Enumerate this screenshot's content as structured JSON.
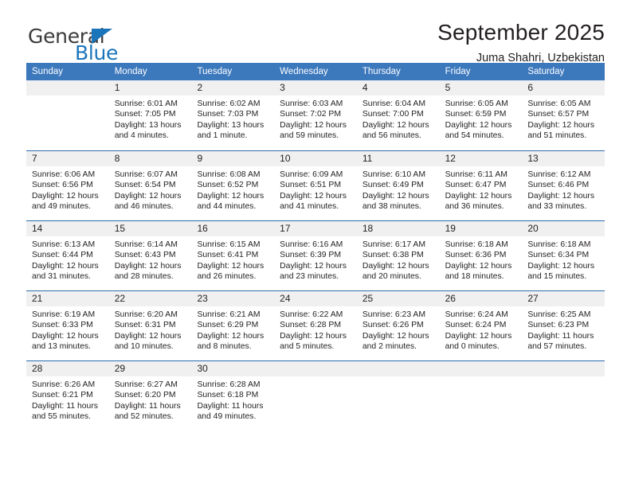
{
  "logo": {
    "word_top": "General",
    "word_bottom": "Blue",
    "triangle_color": "#1b75bb"
  },
  "header": {
    "title": "September 2025",
    "subtitle": "Juma Shahri, Uzbekistan"
  },
  "theme": {
    "header_blue": "#3c78bc",
    "row_divider_blue": "#2b6cb0",
    "day_number_band": "#f0f0f0",
    "text": "#231f20"
  },
  "calendar": {
    "weekdays": [
      "Sunday",
      "Monday",
      "Tuesday",
      "Wednesday",
      "Thursday",
      "Friday",
      "Saturday"
    ],
    "weeks": [
      [
        {
          "day": "",
          "sunrise": "",
          "sunset": "",
          "daylight_line1": "",
          "daylight_line2": ""
        },
        {
          "day": "1",
          "sunrise": "Sunrise: 6:01 AM",
          "sunset": "Sunset: 7:05 PM",
          "daylight_line1": "Daylight: 13 hours",
          "daylight_line2": "and 4 minutes."
        },
        {
          "day": "2",
          "sunrise": "Sunrise: 6:02 AM",
          "sunset": "Sunset: 7:03 PM",
          "daylight_line1": "Daylight: 13 hours",
          "daylight_line2": "and 1 minute."
        },
        {
          "day": "3",
          "sunrise": "Sunrise: 6:03 AM",
          "sunset": "Sunset: 7:02 PM",
          "daylight_line1": "Daylight: 12 hours",
          "daylight_line2": "and 59 minutes."
        },
        {
          "day": "4",
          "sunrise": "Sunrise: 6:04 AM",
          "sunset": "Sunset: 7:00 PM",
          "daylight_line1": "Daylight: 12 hours",
          "daylight_line2": "and 56 minutes."
        },
        {
          "day": "5",
          "sunrise": "Sunrise: 6:05 AM",
          "sunset": "Sunset: 6:59 PM",
          "daylight_line1": "Daylight: 12 hours",
          "daylight_line2": "and 54 minutes."
        },
        {
          "day": "6",
          "sunrise": "Sunrise: 6:05 AM",
          "sunset": "Sunset: 6:57 PM",
          "daylight_line1": "Daylight: 12 hours",
          "daylight_line2": "and 51 minutes."
        }
      ],
      [
        {
          "day": "7",
          "sunrise": "Sunrise: 6:06 AM",
          "sunset": "Sunset: 6:56 PM",
          "daylight_line1": "Daylight: 12 hours",
          "daylight_line2": "and 49 minutes."
        },
        {
          "day": "8",
          "sunrise": "Sunrise: 6:07 AM",
          "sunset": "Sunset: 6:54 PM",
          "daylight_line1": "Daylight: 12 hours",
          "daylight_line2": "and 46 minutes."
        },
        {
          "day": "9",
          "sunrise": "Sunrise: 6:08 AM",
          "sunset": "Sunset: 6:52 PM",
          "daylight_line1": "Daylight: 12 hours",
          "daylight_line2": "and 44 minutes."
        },
        {
          "day": "10",
          "sunrise": "Sunrise: 6:09 AM",
          "sunset": "Sunset: 6:51 PM",
          "daylight_line1": "Daylight: 12 hours",
          "daylight_line2": "and 41 minutes."
        },
        {
          "day": "11",
          "sunrise": "Sunrise: 6:10 AM",
          "sunset": "Sunset: 6:49 PM",
          "daylight_line1": "Daylight: 12 hours",
          "daylight_line2": "and 38 minutes."
        },
        {
          "day": "12",
          "sunrise": "Sunrise: 6:11 AM",
          "sunset": "Sunset: 6:47 PM",
          "daylight_line1": "Daylight: 12 hours",
          "daylight_line2": "and 36 minutes."
        },
        {
          "day": "13",
          "sunrise": "Sunrise: 6:12 AM",
          "sunset": "Sunset: 6:46 PM",
          "daylight_line1": "Daylight: 12 hours",
          "daylight_line2": "and 33 minutes."
        }
      ],
      [
        {
          "day": "14",
          "sunrise": "Sunrise: 6:13 AM",
          "sunset": "Sunset: 6:44 PM",
          "daylight_line1": "Daylight: 12 hours",
          "daylight_line2": "and 31 minutes."
        },
        {
          "day": "15",
          "sunrise": "Sunrise: 6:14 AM",
          "sunset": "Sunset: 6:43 PM",
          "daylight_line1": "Daylight: 12 hours",
          "daylight_line2": "and 28 minutes."
        },
        {
          "day": "16",
          "sunrise": "Sunrise: 6:15 AM",
          "sunset": "Sunset: 6:41 PM",
          "daylight_line1": "Daylight: 12 hours",
          "daylight_line2": "and 26 minutes."
        },
        {
          "day": "17",
          "sunrise": "Sunrise: 6:16 AM",
          "sunset": "Sunset: 6:39 PM",
          "daylight_line1": "Daylight: 12 hours",
          "daylight_line2": "and 23 minutes."
        },
        {
          "day": "18",
          "sunrise": "Sunrise: 6:17 AM",
          "sunset": "Sunset: 6:38 PM",
          "daylight_line1": "Daylight: 12 hours",
          "daylight_line2": "and 20 minutes."
        },
        {
          "day": "19",
          "sunrise": "Sunrise: 6:18 AM",
          "sunset": "Sunset: 6:36 PM",
          "daylight_line1": "Daylight: 12 hours",
          "daylight_line2": "and 18 minutes."
        },
        {
          "day": "20",
          "sunrise": "Sunrise: 6:18 AM",
          "sunset": "Sunset: 6:34 PM",
          "daylight_line1": "Daylight: 12 hours",
          "daylight_line2": "and 15 minutes."
        }
      ],
      [
        {
          "day": "21",
          "sunrise": "Sunrise: 6:19 AM",
          "sunset": "Sunset: 6:33 PM",
          "daylight_line1": "Daylight: 12 hours",
          "daylight_line2": "and 13 minutes."
        },
        {
          "day": "22",
          "sunrise": "Sunrise: 6:20 AM",
          "sunset": "Sunset: 6:31 PM",
          "daylight_line1": "Daylight: 12 hours",
          "daylight_line2": "and 10 minutes."
        },
        {
          "day": "23",
          "sunrise": "Sunrise: 6:21 AM",
          "sunset": "Sunset: 6:29 PM",
          "daylight_line1": "Daylight: 12 hours",
          "daylight_line2": "and 8 minutes."
        },
        {
          "day": "24",
          "sunrise": "Sunrise: 6:22 AM",
          "sunset": "Sunset: 6:28 PM",
          "daylight_line1": "Daylight: 12 hours",
          "daylight_line2": "and 5 minutes."
        },
        {
          "day": "25",
          "sunrise": "Sunrise: 6:23 AM",
          "sunset": "Sunset: 6:26 PM",
          "daylight_line1": "Daylight: 12 hours",
          "daylight_line2": "and 2 minutes."
        },
        {
          "day": "26",
          "sunrise": "Sunrise: 6:24 AM",
          "sunset": "Sunset: 6:24 PM",
          "daylight_line1": "Daylight: 12 hours",
          "daylight_line2": "and 0 minutes."
        },
        {
          "day": "27",
          "sunrise": "Sunrise: 6:25 AM",
          "sunset": "Sunset: 6:23 PM",
          "daylight_line1": "Daylight: 11 hours",
          "daylight_line2": "and 57 minutes."
        }
      ],
      [
        {
          "day": "28",
          "sunrise": "Sunrise: 6:26 AM",
          "sunset": "Sunset: 6:21 PM",
          "daylight_line1": "Daylight: 11 hours",
          "daylight_line2": "and 55 minutes."
        },
        {
          "day": "29",
          "sunrise": "Sunrise: 6:27 AM",
          "sunset": "Sunset: 6:20 PM",
          "daylight_line1": "Daylight: 11 hours",
          "daylight_line2": "and 52 minutes."
        },
        {
          "day": "30",
          "sunrise": "Sunrise: 6:28 AM",
          "sunset": "Sunset: 6:18 PM",
          "daylight_line1": "Daylight: 11 hours",
          "daylight_line2": "and 49 minutes."
        },
        {
          "day": "",
          "sunrise": "",
          "sunset": "",
          "daylight_line1": "",
          "daylight_line2": ""
        },
        {
          "day": "",
          "sunrise": "",
          "sunset": "",
          "daylight_line1": "",
          "daylight_line2": ""
        },
        {
          "day": "",
          "sunrise": "",
          "sunset": "",
          "daylight_line1": "",
          "daylight_line2": ""
        },
        {
          "day": "",
          "sunrise": "",
          "sunset": "",
          "daylight_line1": "",
          "daylight_line2": ""
        }
      ]
    ]
  }
}
